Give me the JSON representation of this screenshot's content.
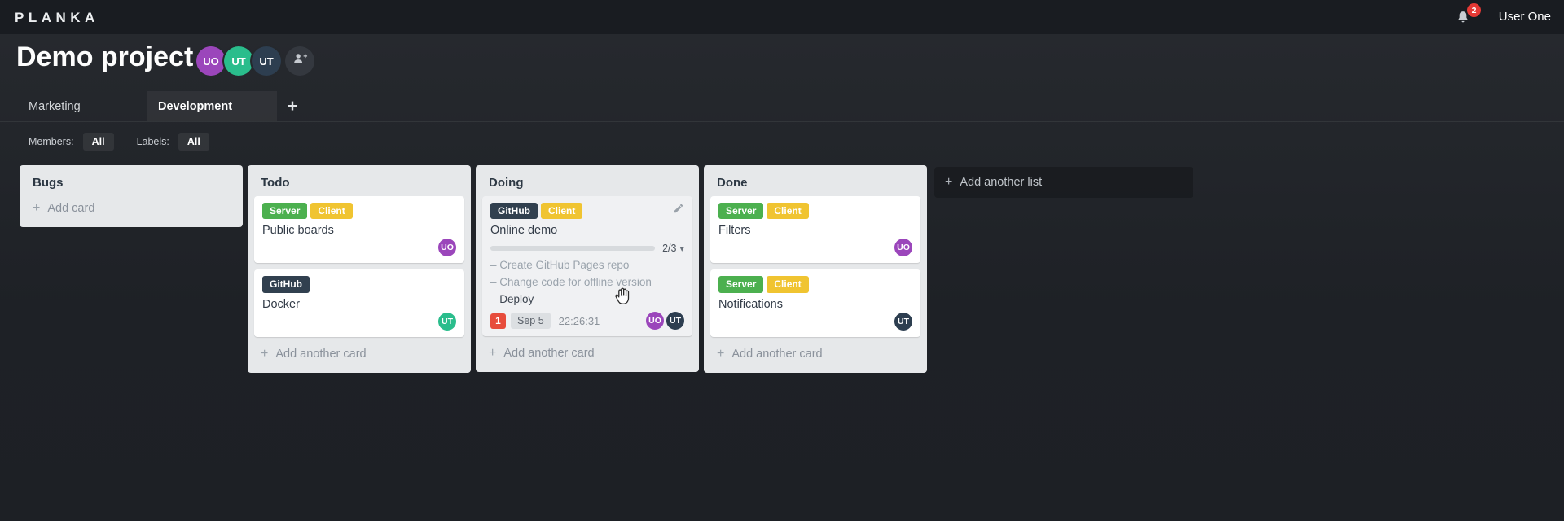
{
  "topbar": {
    "logo": "PLANKA",
    "user_name": "User One",
    "notifications": {
      "count": "2",
      "badge_color": "#e53935"
    }
  },
  "project": {
    "title": "Demo project",
    "members": [
      {
        "initials": "UO",
        "color": "#9b46bb"
      },
      {
        "initials": "UT",
        "color": "#2abd8c"
      },
      {
        "initials": "UT",
        "color": "#2d3e50"
      }
    ]
  },
  "tabs": {
    "items": [
      {
        "label": "Marketing"
      },
      {
        "label": "Development"
      }
    ],
    "add_button": "+"
  },
  "filters": {
    "members_label": "Members:",
    "members_value": "All",
    "labels_label": "Labels:",
    "labels_value": "All"
  },
  "icons": {
    "plus": "+",
    "chevron_down": "▾",
    "dash": "–"
  },
  "board": {
    "lists": [
      {
        "title": "Bugs",
        "add_card_label": "Add card",
        "cards": []
      },
      {
        "title": "Todo",
        "add_card_label": "Add another card",
        "cards": [
          {
            "title": "Public boards",
            "labels": [
              {
                "name": "Server",
                "color": "#4cb04f"
              },
              {
                "name": "Client",
                "color": "#f0c431"
              }
            ],
            "members": [
              {
                "initials": "UO",
                "color": "#9b46bb"
              }
            ]
          },
          {
            "title": "Docker",
            "labels": [
              {
                "name": "GitHub",
                "color": "#31404f"
              }
            ],
            "members": [
              {
                "initials": "UT",
                "color": "#2abd8c"
              }
            ]
          }
        ]
      },
      {
        "title": "Doing",
        "add_card_label": "Add another card",
        "cards": [
          {
            "title": "Online demo",
            "labels": [
              {
                "name": "GitHub",
                "color": "#31404f"
              },
              {
                "name": "Client",
                "color": "#f0c431"
              }
            ],
            "progress": {
              "completed": 2,
              "total": 3,
              "label": "2/3",
              "fill_width": "63%",
              "color": "#1e87d2"
            },
            "tasks": [
              {
                "text": "Create GitHub Pages repo",
                "done": true
              },
              {
                "text": "Change code for offline version",
                "done": true
              },
              {
                "text": "Deploy",
                "done": false
              }
            ],
            "notification_count": "1",
            "notification_color": "#e74c3c",
            "due_date": "Sep 5",
            "timer": "22:26:31",
            "members": [
              {
                "initials": "UO",
                "color": "#9b46bb"
              },
              {
                "initials": "UT",
                "color": "#2d3e50"
              }
            ]
          }
        ]
      },
      {
        "title": "Done",
        "add_card_label": "Add another card",
        "cards": [
          {
            "title": "Filters",
            "labels": [
              {
                "name": "Server",
                "color": "#4cb04f"
              },
              {
                "name": "Client",
                "color": "#f0c431"
              }
            ],
            "members": [
              {
                "initials": "UO",
                "color": "#9b46bb"
              }
            ]
          },
          {
            "title": "Notifications",
            "labels": [
              {
                "name": "Server",
                "color": "#4cb04f"
              },
              {
                "name": "Client",
                "color": "#f0c431"
              }
            ],
            "members": [
              {
                "initials": "UT",
                "color": "#2d3e50"
              }
            ]
          }
        ]
      }
    ],
    "add_list_label": "Add another list"
  }
}
